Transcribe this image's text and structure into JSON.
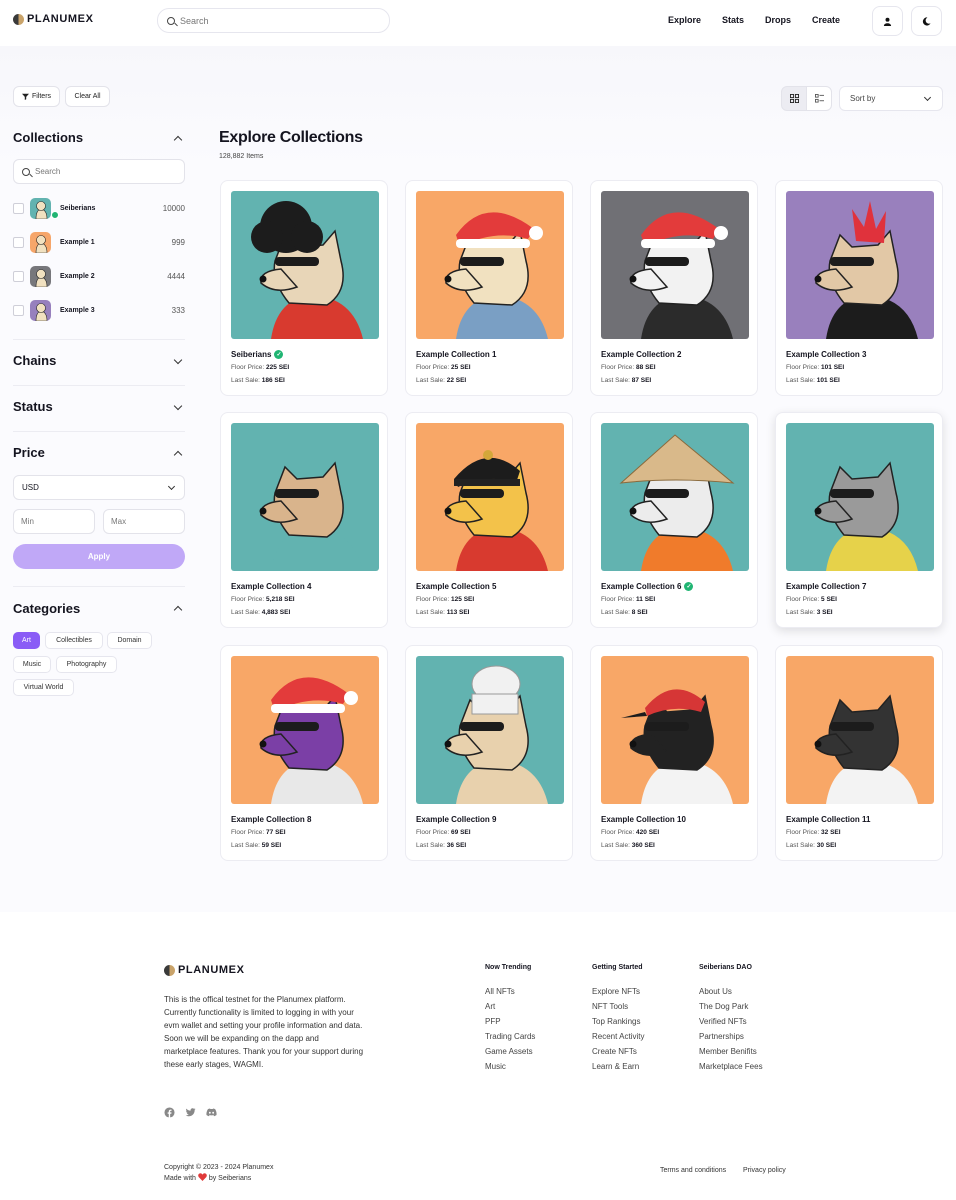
{
  "brand": {
    "name": "PLANUMEX"
  },
  "header": {
    "search_placeholder": "Search",
    "nav": [
      "Explore",
      "Stats",
      "Drops",
      "Create"
    ]
  },
  "toolbar": {
    "filters_label": "Filters",
    "clear_all_label": "Clear All",
    "sort_label": "Sort by"
  },
  "sidebar": {
    "collections_title": "Collections",
    "search_placeholder": "Search",
    "collections": [
      {
        "name": "Seiberians",
        "count": "10000",
        "verified": true,
        "bg": "#62b3b0"
      },
      {
        "name": "Example 1",
        "count": "999",
        "verified": false,
        "bg": "#f6a66a"
      },
      {
        "name": "Example 2",
        "count": "4444",
        "verified": false,
        "bg": "#77777b"
      },
      {
        "name": "Example 3",
        "count": "333",
        "verified": false,
        "bg": "#9780bd"
      }
    ],
    "chains_title": "Chains",
    "status_title": "Status",
    "price_title": "Price",
    "currency": "USD",
    "min_placeholder": "Min",
    "max_placeholder": "Max",
    "apply_label": "Apply",
    "categories_title": "Categories",
    "categories": [
      "Art",
      "Collectibles",
      "Domain",
      "Music",
      "Photography",
      "Virtual World"
    ],
    "active_category": "Art"
  },
  "main": {
    "title": "Explore Collections",
    "items_count": "128,882 Items",
    "floor_label": "Floor Price:",
    "last_label": "Last Sale:",
    "cards": [
      {
        "name": "Seiberians",
        "floor": "225 SEI",
        "last": "186 SEI",
        "verified": true,
        "bg": "#62b3b0"
      },
      {
        "name": "Example Collection 1",
        "floor": "25 SEI",
        "last": "22 SEI",
        "verified": false,
        "bg": "#f8a767"
      },
      {
        "name": "Example Collection 2",
        "floor": "88 SEI",
        "last": "87 SEI",
        "verified": false,
        "bg": "#707075"
      },
      {
        "name": "Example Collection 3",
        "floor": "101 SEI",
        "last": "101 SEI",
        "verified": false,
        "bg": "#9980bd"
      },
      {
        "name": "Example Collection 4",
        "floor": "5,218 SEI",
        "last": "4,883 SEI",
        "verified": false,
        "bg": "#62b3b0"
      },
      {
        "name": "Example Collection 5",
        "floor": "125 SEI",
        "last": "113 SEI",
        "verified": false,
        "bg": "#f8a767"
      },
      {
        "name": "Example Collection 6",
        "floor": "11 SEI",
        "last": "8 SEI",
        "verified": true,
        "bg": "#62b3b0"
      },
      {
        "name": "Example Collection 7",
        "floor": "5 SEI",
        "last": "3 SEI",
        "verified": false,
        "bg": "#62b3b0"
      },
      {
        "name": "Example Collection 8",
        "floor": "77 SEI",
        "last": "59 SEI",
        "verified": false,
        "bg": "#f8a767"
      },
      {
        "name": "Example Collection 9",
        "floor": "69 SEI",
        "last": "36 SEI",
        "verified": false,
        "bg": "#62b3b0"
      },
      {
        "name": "Example Collection 10",
        "floor": "420 SEI",
        "last": "360 SEI",
        "verified": false,
        "bg": "#f8a767"
      },
      {
        "name": "Example Collection 11",
        "floor": "32 SEI",
        "last": "30 SEI",
        "verified": false,
        "bg": "#f8a767"
      }
    ]
  },
  "footer": {
    "description": "This is the offical testnet for the Planumex platform. Currently functionality is limited to logging in with your evm wallet and setting your profile information and data. Soon we will be expanding on the dapp and marketplace features. Thank you for your support during these early stages, WAGMI.",
    "columns": [
      {
        "title": "Now Trending",
        "links": [
          "All NFTs",
          "Art",
          "PFP",
          "Trading Cards",
          "Game Assets",
          "Music"
        ]
      },
      {
        "title": "Getting Started",
        "links": [
          "Explore NFTs",
          "NFT Tools",
          "Top Rankings",
          "Recent Activity",
          "Create NFTs",
          "Learn & Earn"
        ]
      },
      {
        "title": "Seiberians DAO",
        "links": [
          "About Us",
          "The Dog Park",
          "Verified NFTs",
          "Partnerships",
          "Member Benifits",
          "Marketplace Fees"
        ]
      }
    ],
    "copyright": "Copyright © 2023 - 2024 Planumex",
    "made_with_prefix": "Made with",
    "made_with_suffix": "by Seiberians",
    "terms": "Terms and conditions",
    "privacy": "Privacy policy"
  },
  "icons": [
    "search-icon",
    "user-icon",
    "moon-icon",
    "filter-icon",
    "grid-view-icon",
    "list-view-icon",
    "chevron-icon",
    "verified-icon",
    "facebook-icon",
    "twitter-icon",
    "discord-icon",
    "heart-icon"
  ],
  "colors": {
    "accent": "#8a5cf6",
    "apply": "#c0a8f7",
    "verified": "#21b573"
  }
}
